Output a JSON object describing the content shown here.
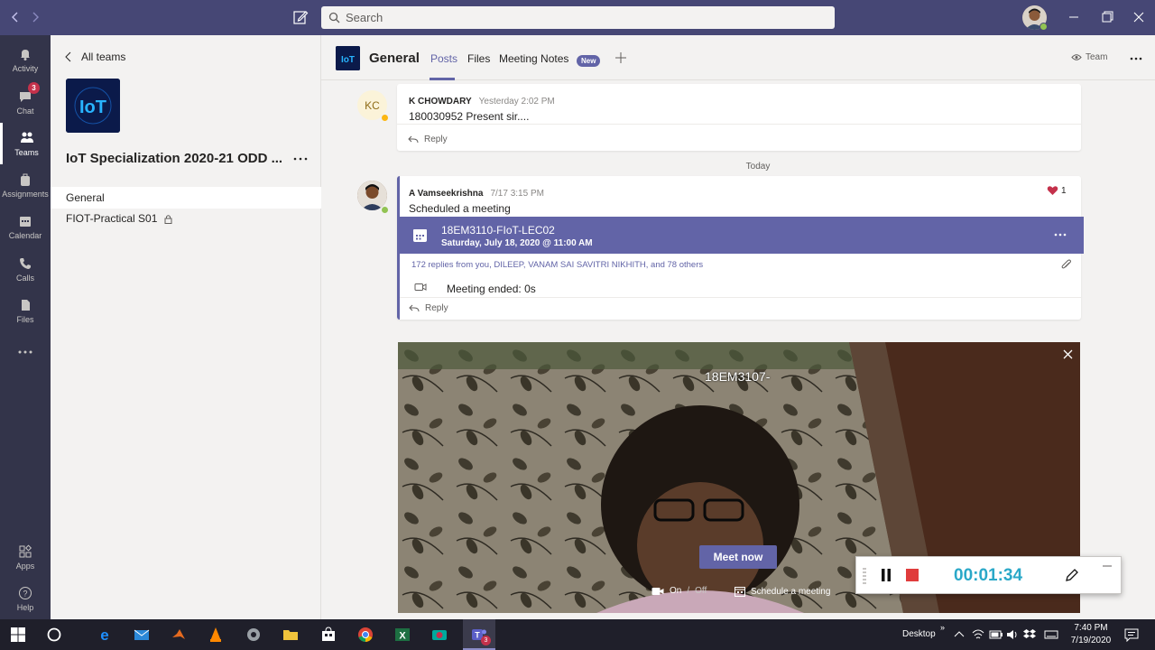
{
  "titlebar": {
    "search_placeholder": "Search"
  },
  "rail": {
    "activity": "Activity",
    "chat": "Chat",
    "chat_badge": "3",
    "teams": "Teams",
    "assignments": "Assignments",
    "calendar": "Calendar",
    "calls": "Calls",
    "files": "Files",
    "apps": "Apps",
    "help": "Help"
  },
  "team_panel": {
    "all_teams": "All teams",
    "team_name": "IoT Specialization 2020-21 ODD ...",
    "channels": [
      {
        "name": "General"
      },
      {
        "name": "FIOT-Practical S01"
      }
    ]
  },
  "channel_header": {
    "title": "General",
    "tabs": [
      "Posts",
      "Files",
      "Meeting Notes"
    ],
    "new_badge": "New",
    "team_button": "Team"
  },
  "feed": {
    "post1": {
      "initials": "KC",
      "author": "K CHOWDARY",
      "time": "Yesterday 2:02 PM",
      "text": "180030952 Present sir....",
      "reply": "Reply"
    },
    "date_divider": "Today",
    "post2": {
      "author": "A Vamseekrishna",
      "time": "7/17 3:15 PM",
      "text": "Scheduled a meeting",
      "reaction_count": "1",
      "meeting_title": "18EM3110-FIoT-LEC02",
      "meeting_date": "Saturday, July 18, 2020 @ 11:00 AM",
      "replies": "172 replies from you, DILEEP, VANAM SAI SAVITRI NIKHITH, and 78 others",
      "meeting_ended": "Meeting ended: 0s",
      "reply": "Reply"
    }
  },
  "video": {
    "overlay_text": "18EM3107-",
    "meet_now": "Meet now",
    "camera_on": "On",
    "camera_sep": "/",
    "camera_off": "Off",
    "schedule": "Schedule a meeting"
  },
  "recorder": {
    "time": "00:01:34"
  },
  "taskbar": {
    "desktop_label": "Desktop",
    "time": "7:40 PM",
    "date": "7/19/2020",
    "teams_badge": "3"
  },
  "colors": {
    "brand": "#6264a7",
    "titlebar": "#464775",
    "rail": "#33344a"
  }
}
